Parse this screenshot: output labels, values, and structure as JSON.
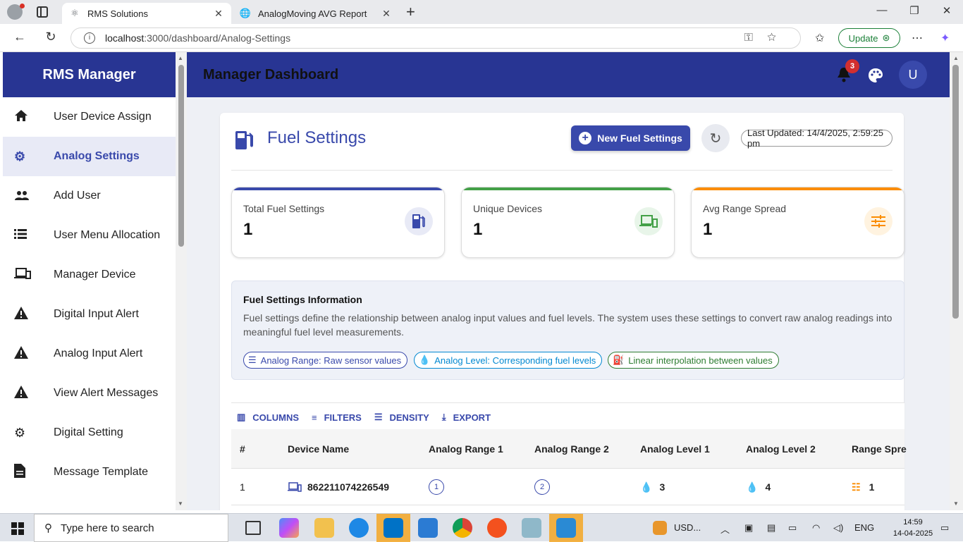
{
  "browser": {
    "tabs": [
      {
        "title": "RMS Solutions",
        "active": true
      },
      {
        "title": "AnalogMoving AVG Report",
        "active": false
      }
    ],
    "url_host": "localhost",
    "url_path": ":3000/dashboard/Analog-Settings",
    "update_label": "Update"
  },
  "sidebar": {
    "title": "RMS Manager",
    "items": [
      {
        "label": "User Device Assign",
        "icon": "home-icon",
        "active": false
      },
      {
        "label": "Analog Settings",
        "icon": "gear-icon",
        "active": true
      },
      {
        "label": "Add User",
        "icon": "people-icon",
        "active": false
      },
      {
        "label": "User Menu Allocation",
        "icon": "list-icon",
        "active": false
      },
      {
        "label": "Manager Device",
        "icon": "devices-icon",
        "active": false
      },
      {
        "label": "Digital Input Alert",
        "icon": "warning-icon",
        "active": false
      },
      {
        "label": "Analog Input Alert",
        "icon": "warning-icon",
        "active": false
      },
      {
        "label": "View Alert Messages",
        "icon": "warning-icon",
        "active": false
      },
      {
        "label": "Digital Setting",
        "icon": "gear-icon",
        "active": false
      },
      {
        "label": "Message Template",
        "icon": "document-icon",
        "active": false
      }
    ]
  },
  "header": {
    "title": "Manager Dashboard",
    "notification_count": "3",
    "avatar_initial": "U"
  },
  "panel": {
    "title": "Fuel Settings",
    "new_button": "New Fuel Settings",
    "last_updated": "Last Updated: 14/4/2025, 2:59:25 pm"
  },
  "stats": [
    {
      "label": "Total Fuel Settings",
      "value": "1",
      "color": "#3949ab"
    },
    {
      "label": "Unique Devices",
      "value": "1",
      "color": "#43a047"
    },
    {
      "label": "Avg Range Spread",
      "value": "1",
      "color": "#fb8c00"
    }
  ],
  "info": {
    "heading": "Fuel Settings Information",
    "body": "Fuel settings define the relationship between analog input values and fuel levels. The system uses these settings to convert raw analog readings into meaningful fuel level measurements.",
    "chips": [
      "Analog Range: Raw sensor values",
      "Analog Level: Corresponding fuel levels",
      "Linear interpolation between values"
    ]
  },
  "grid": {
    "toolbar": [
      "COLUMNS",
      "FILTERS",
      "DENSITY",
      "EXPORT"
    ],
    "columns": [
      "#",
      "Device Name",
      "Analog Range 1",
      "Analog Range 2",
      "Analog Level 1",
      "Analog Level 2",
      "Range Spre"
    ],
    "rows": [
      {
        "index": "1",
        "device": "862211074226549",
        "range1": "1",
        "range2": "2",
        "level1": "3",
        "level2": "4",
        "spread": "1"
      }
    ]
  },
  "taskbar": {
    "search_placeholder": "Type here to search",
    "weather": "USD...",
    "language": "ENG",
    "time": "14:59",
    "date": "14-04-2025"
  }
}
